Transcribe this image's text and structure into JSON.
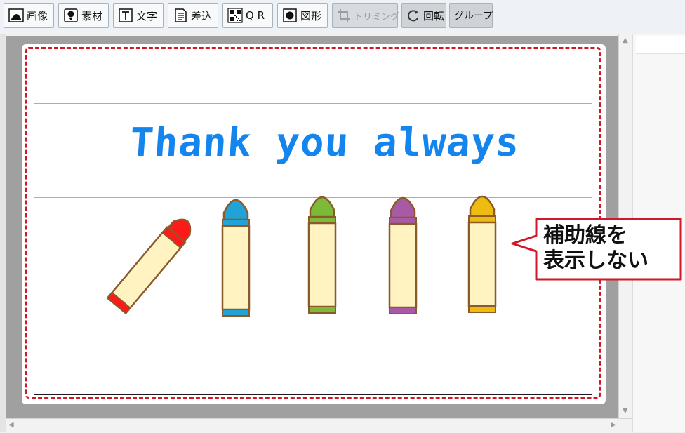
{
  "toolbar": {
    "buttons": [
      {
        "label": "画像",
        "icon": "image-icon"
      },
      {
        "label": "素材",
        "icon": "material-icon"
      },
      {
        "label": "文字",
        "icon": "text-icon"
      },
      {
        "label": "差込",
        "icon": "insert-icon"
      },
      {
        "label": "Q R",
        "icon": "qr-icon"
      },
      {
        "label": "図形",
        "icon": "shape-icon"
      },
      {
        "label": "トリミング",
        "icon": "crop-icon",
        "state": "disabled"
      },
      {
        "label": "回転",
        "icon": "rotate-icon"
      },
      {
        "label": "グループ",
        "icon": ""
      }
    ]
  },
  "card": {
    "text": "Thank you always",
    "text_color": "#1585ee",
    "border_color": "#d0182a",
    "crayon_colors": [
      "#ff1a1a",
      "#22a3d8",
      "#7dba3a",
      "#a85aa5",
      "#eebb11"
    ],
    "crayon_body_color": "#fff3c2"
  },
  "callout": {
    "line1": "補助線を",
    "line2": "表示しない",
    "border_color": "#d0182a"
  }
}
